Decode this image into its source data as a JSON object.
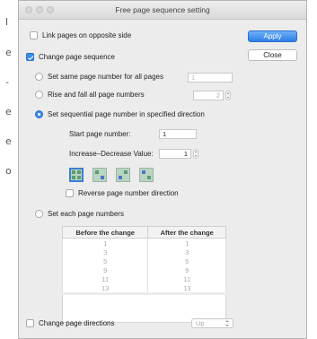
{
  "background_doc": {
    "letters": [
      "l",
      "e",
      "-",
      "e",
      "e",
      "o"
    ]
  },
  "window": {
    "title": "Free page sequence setting"
  },
  "options": {
    "link_opposite": "Link pages on opposite side",
    "change_sequence": "Change page sequence",
    "same_number": "Set same page number for all pages",
    "same_number_value": "1",
    "rise_fall": "Rise and fall all page numbers",
    "rise_fall_value": "2",
    "sequential": "Set sequential page number in specified direction",
    "start_label": "Start page number:",
    "start_value": "1",
    "inc_dec_label": "Increase–Decrease Value:",
    "inc_dec_value": "1",
    "reverse": "Reverse page number direction",
    "each": "Set each page numbers",
    "change_directions": "Change page directions",
    "direction_value": "Up"
  },
  "buttons": {
    "apply": "Apply",
    "close": "Close"
  },
  "table": {
    "headers": [
      "Before the change",
      "After the change"
    ],
    "rows": [
      [
        "1",
        "1"
      ],
      [
        "3",
        "3"
      ],
      [
        "5",
        "5"
      ],
      [
        "9",
        "9"
      ],
      [
        "11",
        "11"
      ],
      [
        "13",
        "13"
      ]
    ]
  },
  "direction_icons": [
    "grid-icon",
    "arrows-icon",
    "arrows-icon",
    "arrows-icon"
  ],
  "colors": {
    "accent": "#3d8be8",
    "icon_fill": "#b9d4c1"
  }
}
